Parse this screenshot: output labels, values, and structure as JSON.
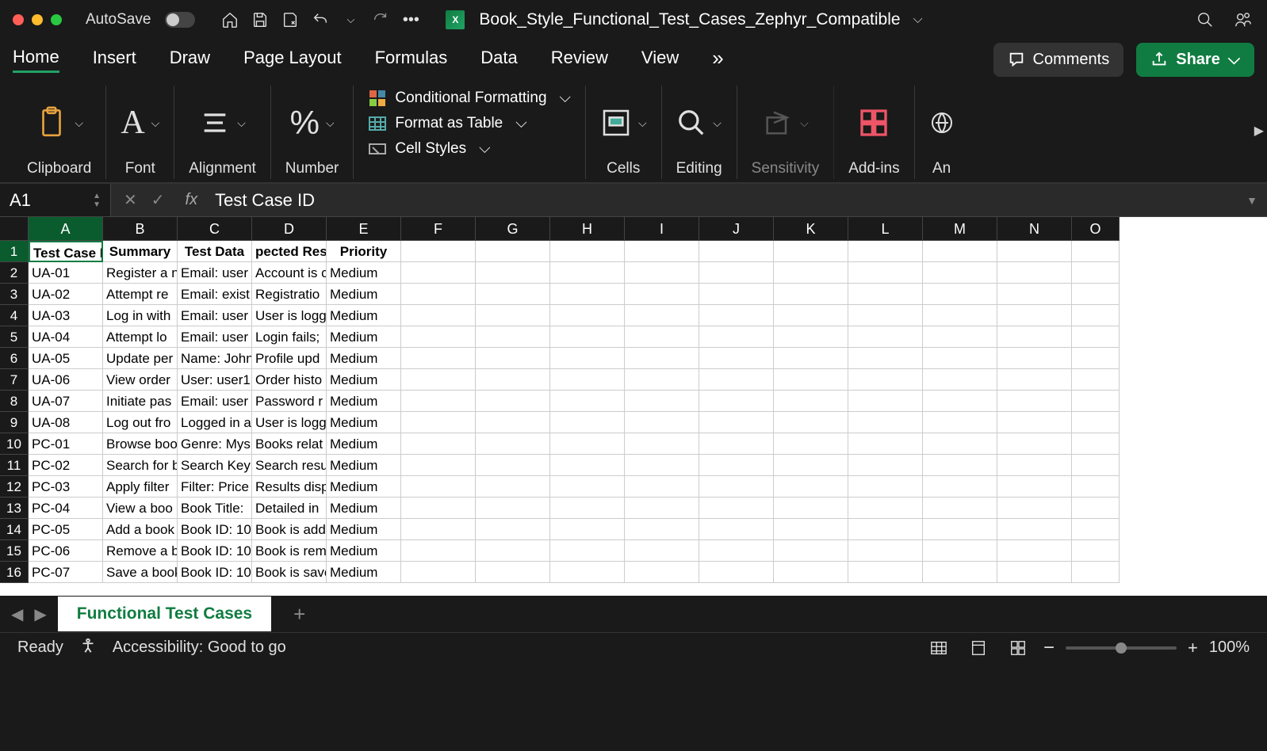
{
  "titlebar": {
    "autosave_label": "AutoSave",
    "doc_title": "Book_Style_Functional_Test_Cases_Zephyr_Compatible"
  },
  "ribbon_tabs": [
    "Home",
    "Insert",
    "Draw",
    "Page Layout",
    "Formulas",
    "Data",
    "Review",
    "View"
  ],
  "ribbon_tabs_active_index": 0,
  "ribbon_right": {
    "comments_label": "Comments",
    "share_label": "Share"
  },
  "ribbon_groups": {
    "clipboard": "Clipboard",
    "font": "Font",
    "alignment": "Alignment",
    "number": "Number",
    "cells": "Cells",
    "editing": "Editing",
    "sensitivity": "Sensitivity",
    "addins": "Add-ins",
    "analyze_prefix": "An",
    "styles": {
      "conditional": "Conditional Formatting",
      "table": "Format as Table",
      "cell_styles": "Cell Styles"
    }
  },
  "formula_bar": {
    "name_box": "A1",
    "fx": "fx",
    "value": "Test Case ID"
  },
  "columns": [
    "A",
    "B",
    "C",
    "D",
    "E",
    "F",
    "G",
    "H",
    "I",
    "J",
    "K",
    "L",
    "M",
    "N",
    "O"
  ],
  "header_row": [
    "Test Case ID",
    "Summary",
    "Test Data",
    "Expected Result",
    "Priority"
  ],
  "header_row_display": [
    "Test Case ID",
    "Summary",
    "Test Data",
    "pected Resu",
    "Priority"
  ],
  "rows": [
    {
      "n": 2,
      "cells": [
        "UA-01",
        "Register a n",
        "Email: user",
        "Account is c",
        "Medium"
      ]
    },
    {
      "n": 3,
      "cells": [
        "UA-02",
        "Attempt re",
        "Email: exist",
        "Registratio",
        "Medium"
      ]
    },
    {
      "n": 4,
      "cells": [
        "UA-03",
        "Log in with",
        "Email: user",
        "User is logg",
        "Medium"
      ]
    },
    {
      "n": 5,
      "cells": [
        "UA-04",
        "Attempt lo",
        "Email: user",
        "Login fails;",
        "Medium"
      ]
    },
    {
      "n": 6,
      "cells": [
        "UA-05",
        "Update per",
        "Name: John",
        "Profile upd",
        "Medium"
      ]
    },
    {
      "n": 7,
      "cells": [
        "UA-06",
        "View order",
        "User: user1",
        "Order histo",
        "Medium"
      ]
    },
    {
      "n": 8,
      "cells": [
        "UA-07",
        "Initiate pas",
        "Email: user",
        "Password r",
        "Medium"
      ]
    },
    {
      "n": 9,
      "cells": [
        "UA-08",
        "Log out fro",
        "Logged in a",
        "User is logg",
        "Medium"
      ]
    },
    {
      "n": 10,
      "cells": [
        "PC-01",
        "Browse boo",
        "Genre: Mys",
        "Books relat",
        "Medium"
      ]
    },
    {
      "n": 11,
      "cells": [
        "PC-02",
        "Search for b",
        "Search Key",
        "Search resu",
        "Medium"
      ]
    },
    {
      "n": 12,
      "cells": [
        "PC-03",
        "Apply filter",
        "Filter: Price",
        "Results disp",
        "Medium"
      ]
    },
    {
      "n": 13,
      "cells": [
        "PC-04",
        "View a boo",
        "Book Title:",
        "Detailed in",
        "Medium"
      ]
    },
    {
      "n": 14,
      "cells": [
        "PC-05",
        "Add a book",
        "Book ID: 10",
        "Book is add",
        "Medium"
      ]
    },
    {
      "n": 15,
      "cells": [
        "PC-06",
        "Remove a b",
        "Book ID: 10",
        "Book is rem",
        "Medium"
      ]
    },
    {
      "n": 16,
      "cells": [
        "PC-07",
        "Save a book",
        "Book ID: 10",
        "Book is save",
        "Medium"
      ]
    }
  ],
  "sheet_tab": "Functional Test Cases",
  "status": {
    "ready": "Ready",
    "accessibility": "Accessibility: Good to go",
    "zoom": "100%"
  }
}
